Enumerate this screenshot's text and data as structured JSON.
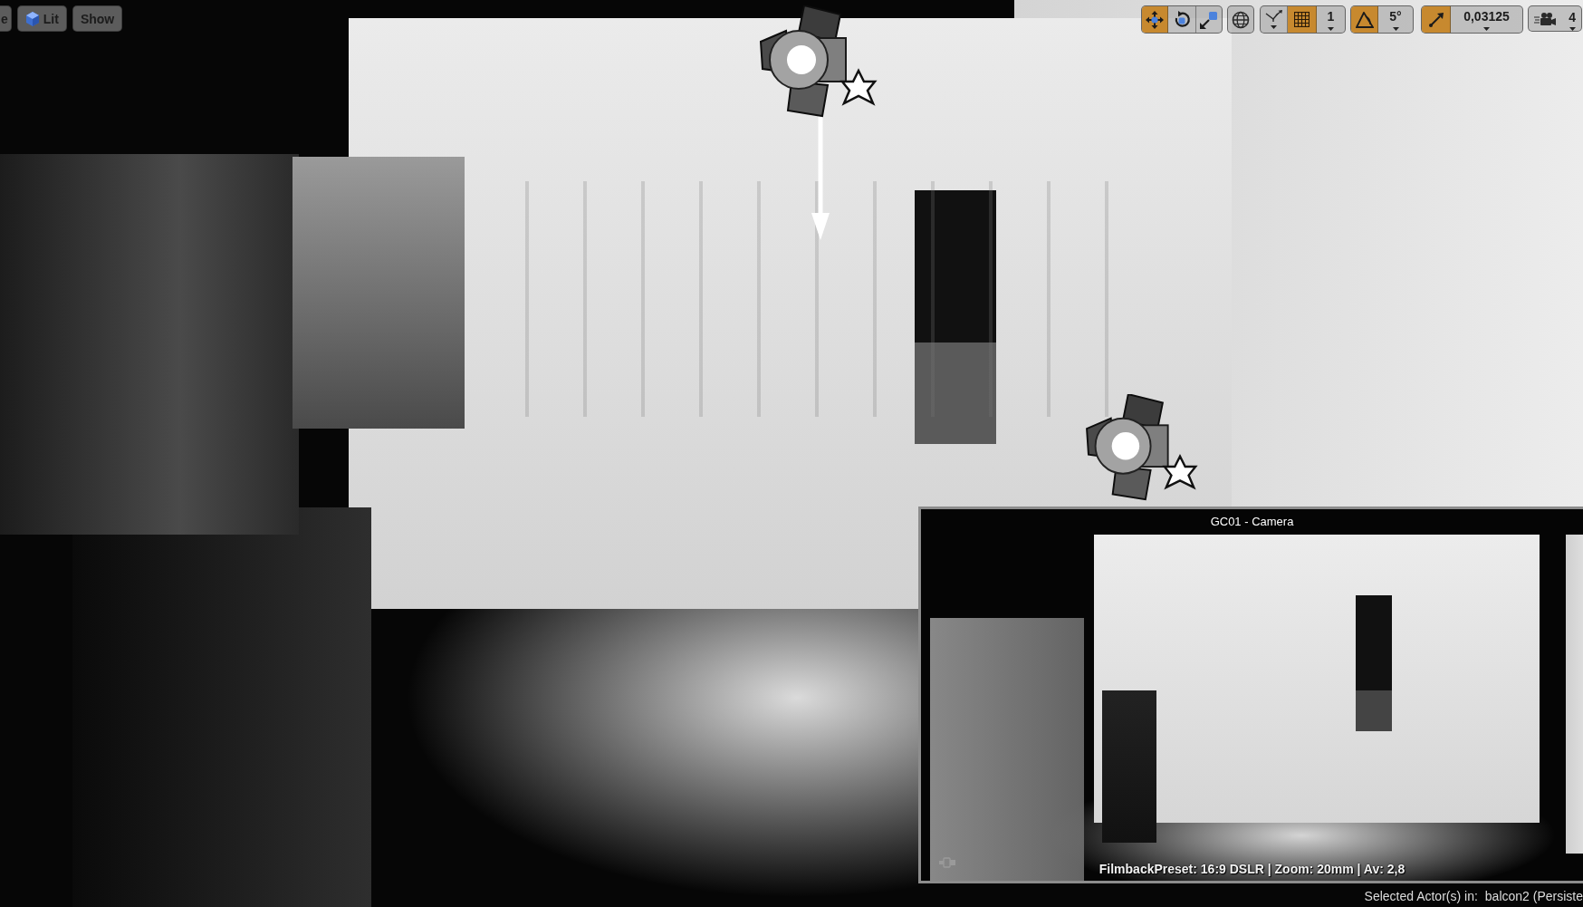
{
  "left_toolbar": [
    {
      "kind": "menu",
      "label": "e"
    },
    {
      "kind": "view_mode",
      "label": "Lit"
    },
    {
      "kind": "menu",
      "label": "Show"
    }
  ],
  "right_toolbar": {
    "transform_tools": [
      {
        "kind": "translate",
        "selected": true
      },
      {
        "kind": "rotate",
        "selected": false
      },
      {
        "kind": "scale",
        "selected": false
      }
    ],
    "surface_snapping": {
      "on": false
    },
    "snaps": [
      {
        "kind": "grid",
        "on": true,
        "value": "1"
      },
      {
        "kind": "rotation",
        "on": true,
        "value": "5°"
      },
      {
        "kind": "scale",
        "on": true,
        "value": "0,03125"
      }
    ],
    "camera_speed": "4"
  },
  "camera_preview": {
    "title": "GC01 - Camera",
    "info": "FilmbackPreset: 16:9 DSLR | Zoom: 20mm | Av: 2,8"
  },
  "status_bar": {
    "label": "Selected Actor(s) in:",
    "level_name": "balcon2 (Persiste"
  }
}
